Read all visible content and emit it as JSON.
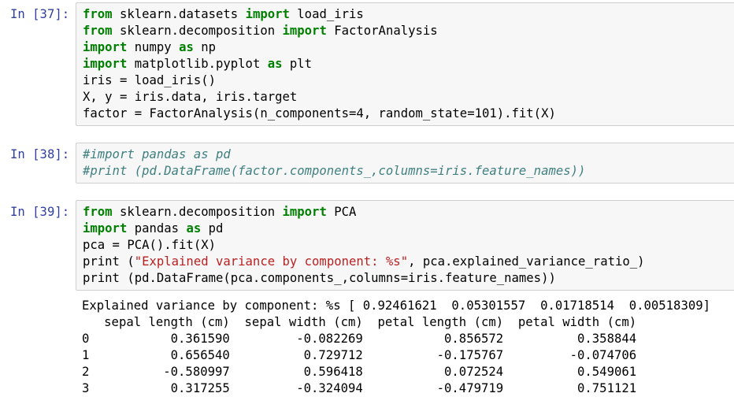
{
  "cells": [
    {
      "prompt": "In [37]:",
      "lines": [
        [
          [
            "kw",
            "from"
          ],
          [
            "t",
            " sklearn.datasets "
          ],
          [
            "kw",
            "import"
          ],
          [
            "t",
            " load_iris"
          ]
        ],
        [
          [
            "kw",
            "from"
          ],
          [
            "t",
            " sklearn.decomposition "
          ],
          [
            "kw",
            "import"
          ],
          [
            "t",
            " FactorAnalysis"
          ]
        ],
        [
          [
            "kw",
            "import"
          ],
          [
            "t",
            " numpy "
          ],
          [
            "kw",
            "as"
          ],
          [
            "t",
            " np"
          ]
        ],
        [
          [
            "kw",
            "import"
          ],
          [
            "t",
            " matplotlib.pyplot "
          ],
          [
            "kw",
            "as"
          ],
          [
            "t",
            " plt"
          ]
        ],
        [
          [
            "t",
            "iris = load_iris()"
          ]
        ],
        [
          [
            "t",
            "X, y = iris.data, iris.target"
          ]
        ],
        [
          [
            "t",
            "factor = FactorAnalysis(n_components=4, random_state=101).fit(X)"
          ]
        ]
      ]
    },
    {
      "prompt": "In [38]:",
      "lines": [
        [
          [
            "cm",
            "#import pandas as pd"
          ]
        ],
        [
          [
            "cm",
            "#print (pd.DataFrame(factor.components_,columns=iris.feature_names))"
          ]
        ]
      ]
    },
    {
      "prompt": "In [39]:",
      "lines": [
        [
          [
            "kw",
            "from"
          ],
          [
            "t",
            " sklearn.decomposition "
          ],
          [
            "kw",
            "import"
          ],
          [
            "t",
            " PCA"
          ]
        ],
        [
          [
            "kw",
            "import"
          ],
          [
            "t",
            " pandas "
          ],
          [
            "kw",
            "as"
          ],
          [
            "t",
            " pd"
          ]
        ],
        [
          [
            "t",
            "pca = PCA().fit(X)"
          ]
        ],
        [
          [
            "t",
            "print ("
          ],
          [
            "str",
            "\"Explained variance by component: %s\""
          ],
          [
            "t",
            ", pca.explained_variance_ratio_)"
          ]
        ],
        [
          [
            "t",
            "print (pd.DataFrame(pca.components_,columns=iris.feature_names))"
          ]
        ]
      ]
    }
  ],
  "output": {
    "lines": [
      "Explained variance by component: %s [ 0.92461621  0.05301557  0.01718514  0.00518309]",
      "   sepal length (cm)  sepal width (cm)  petal length (cm)  petal width (cm)",
      "0           0.361590         -0.082269           0.856572          0.358844",
      "1           0.656540          0.729712          -0.175767         -0.074706",
      "2          -0.580997          0.596418           0.072524          0.549061",
      "3           0.317255         -0.324094          -0.479719          0.751121"
    ]
  }
}
